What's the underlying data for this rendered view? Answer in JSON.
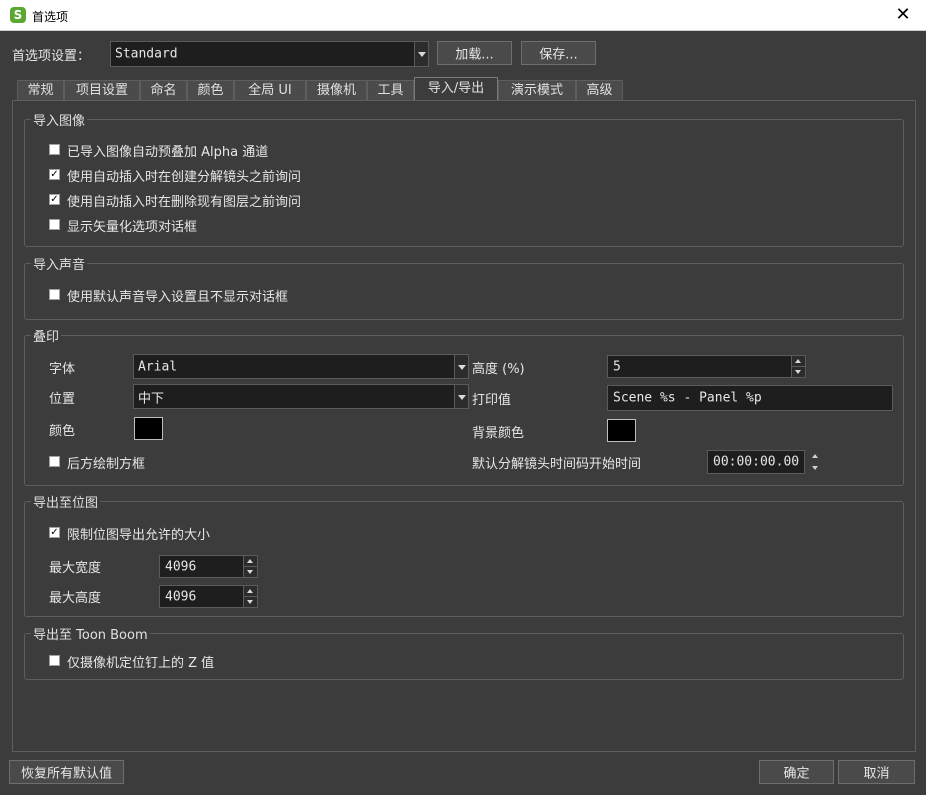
{
  "window": {
    "title": "首选项",
    "app_icon_letter": "S",
    "close_glyph": "✕"
  },
  "header": {
    "pref_label": "首选项设置：",
    "preset_value": "Standard",
    "load_button": "加载...",
    "save_button": "保存..."
  },
  "tabs": [
    {
      "label": "常规"
    },
    {
      "label": "项目设置"
    },
    {
      "label": "命名"
    },
    {
      "label": "颜色"
    },
    {
      "label": "全局 UI"
    },
    {
      "label": "摄像机"
    },
    {
      "label": "工具"
    },
    {
      "label": "导入/导出",
      "active": true
    },
    {
      "label": "演示模式"
    },
    {
      "label": "高级"
    }
  ],
  "import_image": {
    "title": "导入图像",
    "options": [
      {
        "label": "已导入图像自动预叠加 Alpha 通道",
        "checked": false
      },
      {
        "label": "使用自动插入时在创建分解镜头之前询问",
        "checked": true
      },
      {
        "label": "使用自动插入时在删除现有图层之前询问",
        "checked": true
      },
      {
        "label": "显示矢量化选项对话框",
        "checked": false
      }
    ]
  },
  "import_sound": {
    "title": "导入声音",
    "options": [
      {
        "label": "使用默认声音导入设置且不显示对话框",
        "checked": false
      }
    ]
  },
  "watermark": {
    "title": "叠印",
    "font_label": "字体",
    "font_value": "Arial",
    "height_label": "高度 (%)",
    "height_value": "5",
    "position_label": "位置",
    "position_value": "中下",
    "print_label": "打印值",
    "print_value": "Scene %s - Panel %p",
    "color_label": "颜色",
    "color_value": "#000000",
    "bg_color_label": "背景颜色",
    "bg_color_value": "#000000",
    "draw_box_label": "后方绘制方框",
    "draw_box_checked": false,
    "timecode_label": "默认分解镜头时间码开始时间",
    "timecode_value": "00:00:00.00"
  },
  "export_bitmap": {
    "title": "导出至位图",
    "limit_label": "限制位图导出允许的大小",
    "limit_checked": true,
    "max_width_label": "最大宽度",
    "max_width_value": "4096",
    "max_height_label": "最大高度",
    "max_height_value": "4096"
  },
  "export_toonboom": {
    "title": "导出至 Toon Boom",
    "camera_label": "仅摄像机定位钉上的 Z 值",
    "camera_checked": false
  },
  "footer": {
    "restore_button": "恢复所有默认值",
    "ok_button": "确定",
    "cancel_button": "取消"
  }
}
